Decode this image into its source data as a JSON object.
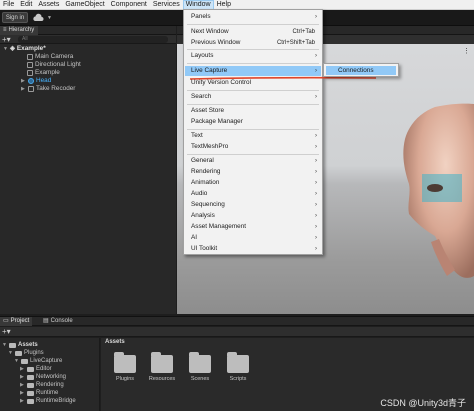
{
  "menubar": [
    "File",
    "Edit",
    "Assets",
    "GameObject",
    "Component",
    "Services",
    "Window",
    "Help"
  ],
  "toolbar": {
    "signin": "Sign in"
  },
  "hierarchy": {
    "tab": "Hierarchy",
    "search_placeholder": "All",
    "scene": "Example*",
    "items": [
      "Main Camera",
      "Directional Light",
      "Example",
      "Head",
      "Take Recoder"
    ]
  },
  "window_menu": {
    "panels": "Panels",
    "next_window": "Next Window",
    "next_window_shortcut": "Ctrl+Tab",
    "previous_window": "Previous Window",
    "previous_window_shortcut": "Ctrl+Shift+Tab",
    "layouts": "Layouts",
    "live_capture": "Live Capture",
    "unity_version_control": "Unity Version Control",
    "search": "Search",
    "asset_store": "Asset Store",
    "package_manager": "Package Manager",
    "text": "Text",
    "textmeshpro": "TextMeshPro",
    "general": "General",
    "rendering": "Rendering",
    "animation": "Animation",
    "audio": "Audio",
    "sequencing": "Sequencing",
    "analysis": "Analysis",
    "asset_management": "Asset Management",
    "ai": "AI",
    "ui_toolkit": "UI Toolkit"
  },
  "submenu": {
    "connections": "Connections"
  },
  "project": {
    "tab_project": "Project",
    "tab_console": "Console",
    "tree": [
      "Assets",
      "Plugins",
      "LiveCapture",
      "Editor",
      "Networking",
      "Rendering",
      "Runtime",
      "RuntimeBridge"
    ],
    "breadcrumb": "Assets",
    "folders": [
      "Plugins",
      "Resources",
      "Scenes",
      "Scripts"
    ]
  },
  "watermark": "CSDN @Unity3d青子",
  "colors": {
    "highlight": "#91c9f7",
    "underline": "#e0452a",
    "selection": "#47b4ff"
  }
}
